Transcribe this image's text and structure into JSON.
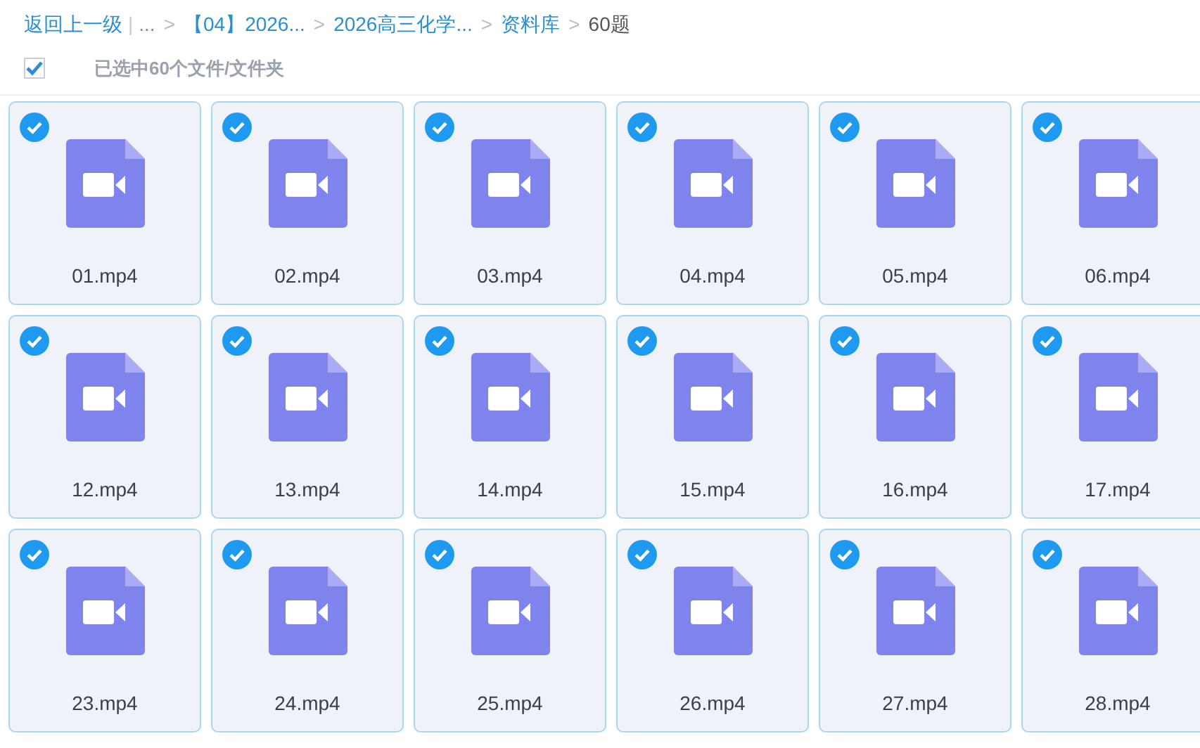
{
  "breadcrumb": [
    {
      "text": "返回上一级",
      "kind": "link"
    },
    {
      "text": "|",
      "kind": "divider"
    },
    {
      "text": "...",
      "kind": "muted"
    },
    {
      "text": ">",
      "kind": "sep"
    },
    {
      "text": "【04】2026...",
      "kind": "link"
    },
    {
      "text": ">",
      "kind": "sep"
    },
    {
      "text": "2026高三化学...",
      "kind": "link"
    },
    {
      "text": ">",
      "kind": "sep"
    },
    {
      "text": "资料库",
      "kind": "link"
    },
    {
      "text": ">",
      "kind": "sep"
    },
    {
      "text": "60题",
      "kind": "current"
    }
  ],
  "select_all": {
    "checked": true,
    "label": "已选中60个文件/文件夹"
  },
  "files": [
    {
      "name": "01.mp4",
      "selected": true
    },
    {
      "name": "02.mp4",
      "selected": true
    },
    {
      "name": "03.mp4",
      "selected": true
    },
    {
      "name": "04.mp4",
      "selected": true
    },
    {
      "name": "05.mp4",
      "selected": true
    },
    {
      "name": "06.mp4",
      "selected": true
    },
    {
      "name": "12.mp4",
      "selected": true
    },
    {
      "name": "13.mp4",
      "selected": true
    },
    {
      "name": "14.mp4",
      "selected": true
    },
    {
      "name": "15.mp4",
      "selected": true
    },
    {
      "name": "16.mp4",
      "selected": true
    },
    {
      "name": "17.mp4",
      "selected": true
    },
    {
      "name": "23.mp4",
      "selected": true
    },
    {
      "name": "24.mp4",
      "selected": true
    },
    {
      "name": "25.mp4",
      "selected": true
    },
    {
      "name": "26.mp4",
      "selected": true
    },
    {
      "name": "27.mp4",
      "selected": true
    },
    {
      "name": "28.mp4",
      "selected": true
    }
  ]
}
